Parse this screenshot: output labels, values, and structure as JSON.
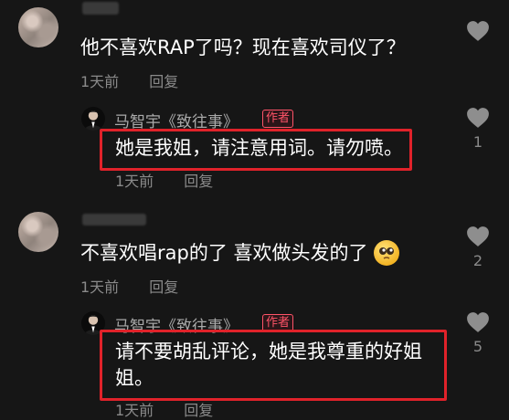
{
  "colors": {
    "background": "#161616",
    "highlight_border": "#e0222a",
    "author_badge": "#ff5468",
    "meta_text": "#8a8a8a"
  },
  "comments": [
    {
      "user": "",
      "text": "他不喜欢RAP了吗？现在喜欢司仪了？",
      "time": "1天前",
      "reply_label": "回复",
      "likes": "",
      "reply": {
        "author": "马智宇《致往事》",
        "badge": "作者",
        "lines": [
          "她是我姐，请注意用词。请勿喷。"
        ],
        "time": "1天前",
        "reply_label": "回复",
        "likes": "1"
      }
    },
    {
      "user": "",
      "text": "不喜欢唱rap的了 喜欢做头发的了",
      "emoji": "pleading-face-emoji",
      "time": "1天前",
      "reply_label": "回复",
      "likes": "2",
      "reply": {
        "author": "马智宇《致往事》",
        "badge": "作者",
        "lines": [
          "请不要胡乱评论，她是我尊重的好姐",
          "姐。"
        ],
        "time": "1天前",
        "reply_label": "回复",
        "likes": "5"
      }
    }
  ]
}
